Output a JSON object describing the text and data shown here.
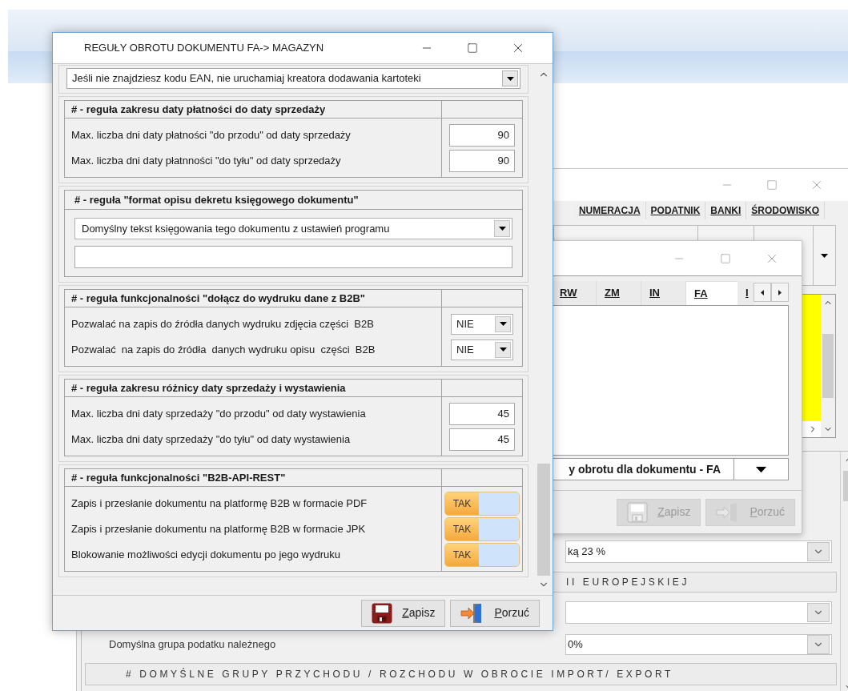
{
  "back_window": {
    "tabs": [
      {
        "label": "NUMERACJA",
        "selected": false
      },
      {
        "label": "PODATNIK",
        "selected": false
      },
      {
        "label": "BANKI",
        "selected": false
      },
      {
        "label": "ŚRODOWISKO",
        "selected": false
      }
    ],
    "rows": [
      {
        "kind": "select",
        "value": "ką 23 %"
      },
      {
        "kind": "heading",
        "text": "II EUROPEJSKIEJ"
      },
      {
        "kind": "select"
      },
      {
        "kind": "labeled_select",
        "label": "Domyślna grupa podatku należnego",
        "value": "0%"
      },
      {
        "kind": "wide_heading",
        "text": "# DOMYŚLNE GRUPY PRZYCHODU / ROZCHODU W OBROCIE IMPORT/ EXPORT"
      }
    ]
  },
  "middle_window": {
    "tabs": [
      {
        "label": "RW",
        "selected": false
      },
      {
        "label": "ZM",
        "selected": false
      },
      {
        "label": "IN",
        "selected": false
      },
      {
        "label": "FA",
        "selected": true
      },
      {
        "label": "I",
        "selected": false
      }
    ],
    "rule_dropdown": "y obrotu dla dokumentu - FA",
    "buttons": [
      {
        "label": "Zapisz",
        "kind": "save",
        "disabled": true
      },
      {
        "label": "Porzuć",
        "kind": "exit",
        "disabled": true
      }
    ]
  },
  "dialog": {
    "title": "REGUŁY OBROTU DOKUMENTU FA-> MAGAZYN",
    "top_dropdown": "Jeśli nie znajdziesz kodu EAN, nie uruchamiaj kreatora dodawania kartoteki",
    "sections": [
      {
        "kind": "table",
        "heading": "# - reguła zakresu daty płatności do daty sprzedaży",
        "rows": [
          {
            "kind": "number",
            "label": "Max. liczba dni daty płatności \"do przodu\" od daty sprzedaży",
            "value": "90"
          },
          {
            "kind": "number",
            "label": "Max. liczba dni daty płatnności \"do tyłu\" od daty sprzedaży",
            "value": "90"
          }
        ]
      },
      {
        "kind": "free",
        "heading": "# - reguła \"format opisu dekretu księgowego dokumentu\"",
        "rows": [
          {
            "kind": "dropdown",
            "value": "Domyślny tekst księgowania tego dokumentu z ustawień programu"
          },
          {
            "kind": "text"
          }
        ]
      },
      {
        "kind": "table",
        "heading": "# - reguła funkcjonalności \"dołącz do wydruku dane z B2B\"",
        "rows": [
          {
            "kind": "select",
            "label": "Pozwalać na zapis do źródła danych wydruku zdjęcia części  B2B",
            "value": "NIE"
          },
          {
            "kind": "select",
            "label": "Pozwalać  na zapis do źródła  danych wydruku opisu  części  B2B",
            "value": "NIE"
          }
        ]
      },
      {
        "kind": "table",
        "heading": "# - reguła zakresu różnicy daty sprzedaży i wystawienia",
        "rows": [
          {
            "kind": "number",
            "label": "Max. liczba dni daty sprzedaży \"do przodu\" od daty wystawienia",
            "value": "45"
          },
          {
            "kind": "number",
            "label": "Max. liczba dni daty sprzedaży \"do tyłu\" od daty wystawienia",
            "value": "45"
          }
        ]
      },
      {
        "kind": "table",
        "heading": "# - reguła funkcjonalności \"B2B-API-REST\"",
        "rows": [
          {
            "kind": "toggle",
            "label": "Zapis i przesłanie dokumentu na platformę B2B w formacie PDF",
            "value": "TAK",
            "on": true
          },
          {
            "kind": "toggle",
            "label": "Zapis i przesłanie dokumentu na platformę B2B w formacie JPK",
            "value": "TAK",
            "on": true
          },
          {
            "kind": "toggle",
            "label": "Blokowanie możliwości edycji dokumentu po jego wydruku",
            "value": "TAK",
            "on": true
          }
        ]
      }
    ],
    "buttons": [
      {
        "label": "Zapisz",
        "kind": "save",
        "disabled": false
      },
      {
        "label": "Porzuć",
        "kind": "exit",
        "disabled": false
      }
    ]
  }
}
